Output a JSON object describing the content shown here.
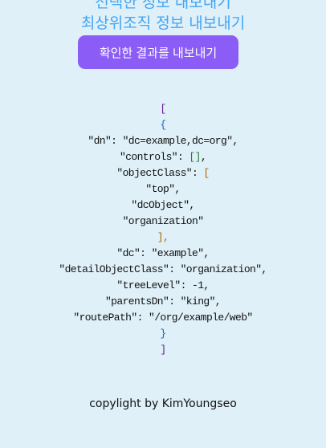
{
  "header": {
    "title_partial": "선택한 정보 내보내기",
    "title": "최상위조직 정보 내보내기"
  },
  "export_button": "확인한 결과를 내보내기",
  "json_lines": {
    "open_array": "[",
    "open_obj": "{",
    "dn": "\"dn\": \"dc=example,dc=org\",",
    "controls_key": "\"controls\": ",
    "controls_val": "[]",
    "comma": ",",
    "oc_key": "\"objectClass\": ",
    "oc_open": "[",
    "oc1": "\"top\",",
    "oc2": "\"dcObject\",",
    "oc3": "\"organization\"",
    "oc_close": "],",
    "dc": "\"dc\": \"example\",",
    "detail": "\"detailObjectClass\": \"organization\",",
    "tree": "\"treeLevel\": -1,",
    "parents": "\"parentsDn\": \"king\",",
    "route": "\"routePath\": \"/org/example/web\"",
    "close_obj": "}",
    "close_array": "]"
  },
  "footer": "copylight by KimYoungseo"
}
